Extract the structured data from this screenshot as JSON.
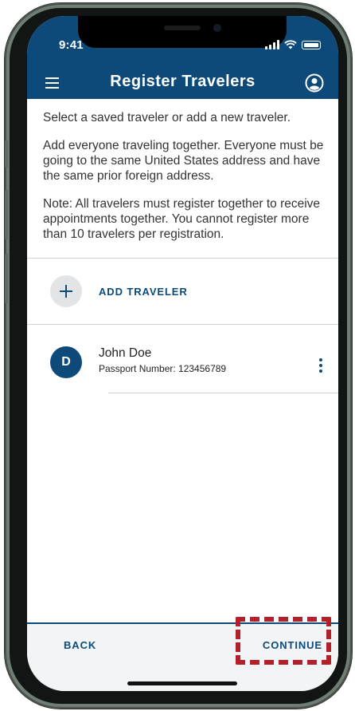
{
  "status_bar": {
    "time": "9:41"
  },
  "header": {
    "title": "Register Travelers",
    "menu_icon": "hamburger-menu-icon",
    "account_icon": "account-circle-icon"
  },
  "intro": {
    "p1": "Select a saved traveler or add a new traveler.",
    "p2": "Add everyone traveling together.  Everyone must be going to the same United States address and have the same prior foreign address.",
    "p3": "Note:  All travelers must register together to receive appointments together. You cannot register more than 10 travelers per registration."
  },
  "add_traveler": {
    "label": "ADD TRAVELER",
    "icon": "plus-icon"
  },
  "travelers": [
    {
      "initial": "D",
      "name": "John Doe",
      "passport": "Passport Number: 123456789"
    }
  ],
  "footer": {
    "back_label": "BACK",
    "continue_label": "CONTINUE"
  },
  "colors": {
    "primary": "#0d4a7a",
    "highlight": "#b3202a",
    "footer_bg": "#f3f4f5"
  }
}
